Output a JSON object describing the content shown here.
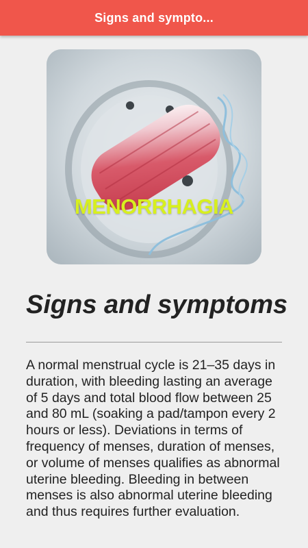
{
  "app_bar": {
    "title": "Signs and sympto..."
  },
  "hero": {
    "caption": "MENORRHAGIA",
    "icon": "menorrhagia-illustration",
    "caption_color": "#d7ef1f"
  },
  "article": {
    "heading": "Signs and symptoms",
    "body": "A normal menstrual cycle is 21–35 days in duration, with bleeding lasting an average of 5 days and total blood flow between 25 and 80 mL (soaking a pad/tampon every 2 hours or less). Deviations in terms of frequency of menses, duration of menses, or volume of menses qualifies as abnormal uterine bleeding. Bleeding in between menses is also abnormal uterine bleeding and thus requires further evaluation."
  },
  "colors": {
    "app_bar": "#f0564b",
    "background": "#efefef",
    "text": "#222222"
  }
}
